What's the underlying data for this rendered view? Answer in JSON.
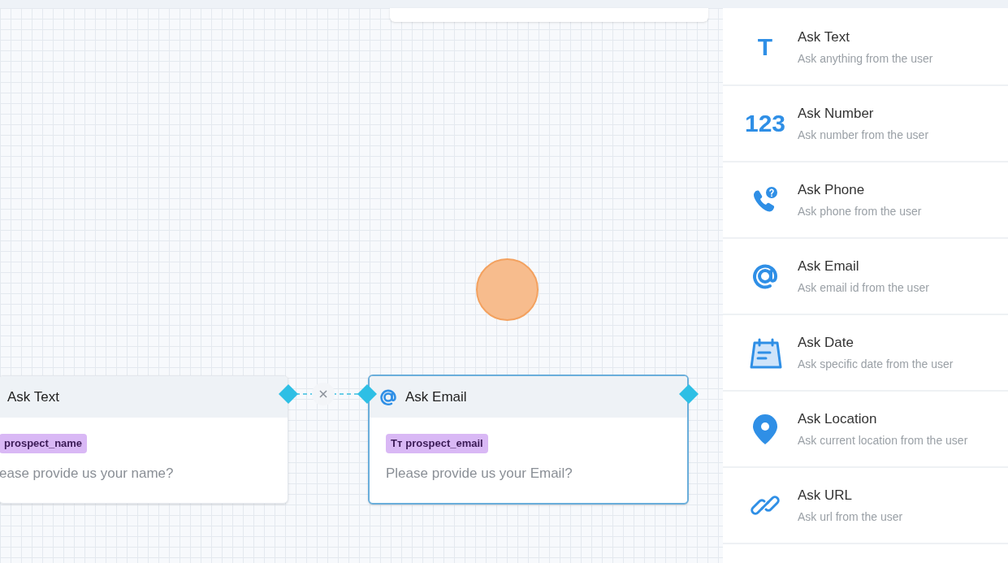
{
  "nodes": [
    {
      "title": "Ask Text",
      "tag": "prospect_name",
      "question": "ease provide us your name?",
      "selected": false,
      "kind": "plain"
    },
    {
      "title": "Ask Email",
      "tag_icon": "Tт",
      "tag": "prospect_email",
      "question": "Please provide us your Email?",
      "selected": true,
      "kind": "email"
    }
  ],
  "sidebar": {
    "items": [
      {
        "kind": "glyph",
        "icon_text": "T",
        "title": "Ask Text",
        "subtitle": "Ask anything from the user"
      },
      {
        "kind": "glyph",
        "icon_text": "123",
        "title": "Ask Number",
        "subtitle": "Ask number from the user"
      },
      {
        "kind": "phone",
        "title": "Ask Phone",
        "subtitle": "Ask phone from the user"
      },
      {
        "kind": "at",
        "title": "Ask Email",
        "subtitle": "Ask email id from the user"
      },
      {
        "kind": "calendar",
        "title": "Ask Date",
        "subtitle": "Ask specific date from the user"
      },
      {
        "kind": "pin",
        "title": "Ask Location",
        "subtitle": "Ask current location from the user"
      },
      {
        "kind": "link",
        "title": "Ask URL",
        "subtitle": "Ask url from the user"
      }
    ]
  }
}
